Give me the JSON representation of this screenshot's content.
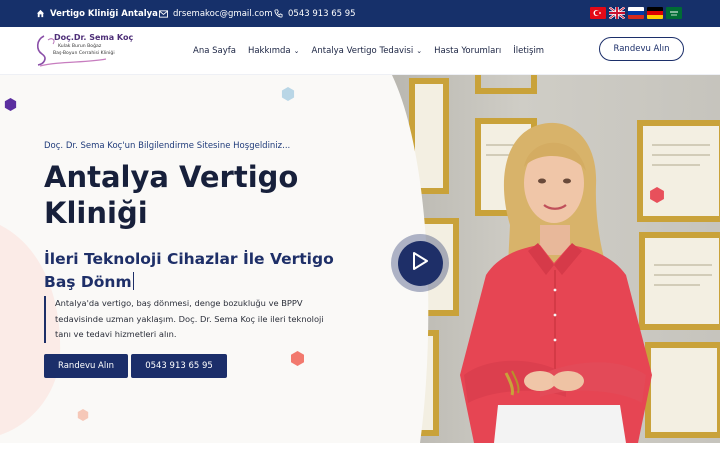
{
  "topbar": {
    "site_title": "Vertigo Kliniği Antalya",
    "email": "drsemakoc@gmail.com",
    "phone": "0543 913 65 95",
    "languages": [
      "tr-flag",
      "en-flag",
      "ru-flag",
      "de-flag",
      "ar-flag"
    ]
  },
  "logo": {
    "name": "Doç.Dr. Sema Koç",
    "sub1": "Kulak Burun Boğaz",
    "sub2": "Baş-Boyun Cerrahisi Kliniği"
  },
  "nav": {
    "items": [
      {
        "label": "Ana Sayfa"
      },
      {
        "label": "Hakkımda"
      },
      {
        "label": "Antalya Vertigo Tedavisi"
      },
      {
        "label": "Hasta Yorumları"
      },
      {
        "label": "İletişim"
      }
    ],
    "cta": "Randevu Alın"
  },
  "hero": {
    "greeting": "Doç. Dr. Sema Koç'un Bilgilendirme Sitesine Hoşgeldiniz...",
    "title": "Antalya Vertigo Kliniği",
    "subtitle": "İleri Teknoloji Cihazlar İle Vertigo Baş Dönm",
    "description": "Antalya'da vertigo, baş dönmesi, denge bozukluğu ve BPPV tedavisinde uzman yaklaşım. Doç. Dr. Sema Koç ile ileri teknoloji tanı ve tedavi hizmetleri alın.",
    "buttons": {
      "appointment": "Randevu Alın",
      "phone": "0543 913 65 95"
    }
  },
  "colors": {
    "primary": "#1b2e6a",
    "accent_pink": "#f2796e",
    "shirt": "#e64553",
    "logo_purple": "#4e2f78"
  },
  "icons": {
    "home": "home-icon",
    "mail": "mail-icon",
    "phone": "phone-icon",
    "play": "play-icon",
    "chevron": "chevron-down-icon"
  }
}
